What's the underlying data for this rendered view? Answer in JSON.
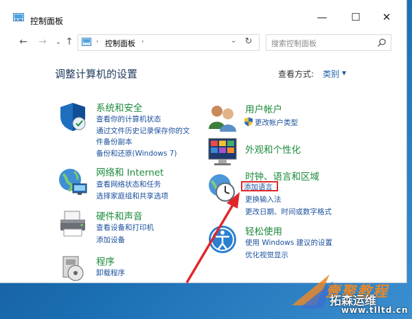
{
  "window": {
    "title": "控制面板",
    "controls": {
      "minimize": "—",
      "maximize": "☐",
      "close": "✕"
    }
  },
  "nav": {
    "back": "←",
    "forward": "→",
    "recent": "⌄",
    "up": "↑",
    "address": "控制面板",
    "address_sep_left": "›",
    "address_sep_right": "›",
    "address_dropdown": "⌄",
    "refresh": "↻",
    "search_placeholder": "搜索控制面板"
  },
  "main": {
    "heading": "调整计算机的设置",
    "view_by_label": "查看方式:",
    "view_by_value": "类别",
    "view_by_arrow": "▼"
  },
  "categories": {
    "security": {
      "title": "系统和安全",
      "links": [
        "查看你的计算机状态",
        "通过文件历史记录保存你的文",
        "件备份副本",
        "备份和还原(Windows 7)"
      ]
    },
    "network": {
      "title": "网络和 Internet",
      "links": [
        "查看网络状态和任务",
        "选择家庭组和共享选项"
      ]
    },
    "hardware": {
      "title": "硬件和声音",
      "links": [
        "查看设备和打印机",
        "添加设备"
      ]
    },
    "programs": {
      "title": "程序",
      "links": [
        "卸载程序"
      ]
    },
    "user": {
      "title": "用户帐户",
      "links": [
        "更改帐户类型"
      ]
    },
    "appearance": {
      "title": "外观和个性化",
      "links": []
    },
    "clock": {
      "title": "时钟、语言和区域",
      "links": [
        "添加语言",
        "更换输入法",
        "更改日期、时间或数字格式"
      ]
    },
    "ease": {
      "title": "轻松使用",
      "links": [
        "使用 Windows 建议的设置",
        "优化视觉显示"
      ]
    }
  },
  "watermark": {
    "line1": "壹聚教程",
    "line2": "拓森运维",
    "line3": "www.tlltd.cn"
  },
  "colors": {
    "category_title": "#1c8a3a",
    "link": "#1a4f9c",
    "highlight_box": "#e0262b",
    "annotation_arrow": "#e0262b",
    "desktop": "#1b6fb3"
  }
}
